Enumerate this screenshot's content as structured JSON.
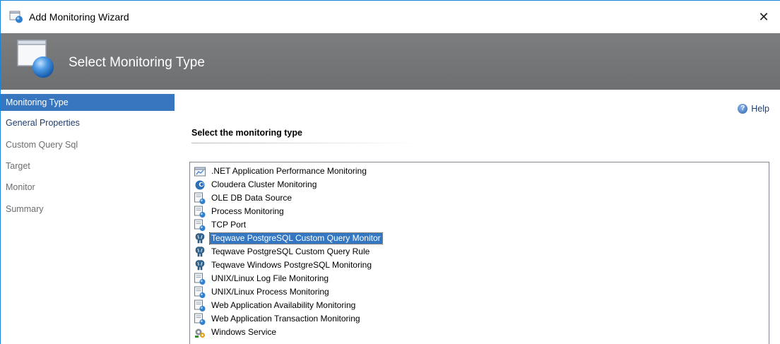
{
  "window": {
    "title": "Add Monitoring Wizard",
    "close_glyph": "✕"
  },
  "banner": {
    "title": "Select Monitoring Type"
  },
  "nav": {
    "items": [
      {
        "label": "Monitoring Type",
        "state": "active"
      },
      {
        "label": "General Properties",
        "state": "done"
      },
      {
        "label": "Custom Query Sql",
        "state": "pending"
      },
      {
        "label": "Target",
        "state": "pending"
      },
      {
        "label": "Monitor",
        "state": "pending"
      },
      {
        "label": "Summary",
        "state": "pending"
      }
    ]
  },
  "content": {
    "help_label": "Help",
    "help_icon": "help-icon",
    "section_title": "Select the monitoring type",
    "monitoring_types": [
      {
        "label": ".NET Application Performance Monitoring",
        "icon": "dotnet-app-icon",
        "selected": false
      },
      {
        "label": "Cloudera Cluster Monitoring",
        "icon": "cloudera-icon",
        "selected": false
      },
      {
        "label": "OLE DB Data Source",
        "icon": "monitor-page-icon",
        "selected": false
      },
      {
        "label": "Process Monitoring",
        "icon": "monitor-page-icon",
        "selected": false
      },
      {
        "label": "TCP Port",
        "icon": "monitor-page-icon",
        "selected": false
      },
      {
        "label": "Teqwave PostgreSQL Custom Query Monitor",
        "icon": "postgresql-elephant-icon",
        "selected": true
      },
      {
        "label": "Teqwave PostgreSQL Custom Query Rule",
        "icon": "postgresql-elephant-icon",
        "selected": false
      },
      {
        "label": "Teqwave Windows PostgreSQL Monitoring",
        "icon": "postgresql-elephant-icon",
        "selected": false
      },
      {
        "label": "UNIX/Linux Log File Monitoring",
        "icon": "monitor-page-icon",
        "selected": false
      },
      {
        "label": "UNIX/Linux Process Monitoring",
        "icon": "monitor-page-icon",
        "selected": false
      },
      {
        "label": "Web Application Availability Monitoring",
        "icon": "monitor-page-icon",
        "selected": false
      },
      {
        "label": "Web Application Transaction Monitoring",
        "icon": "monitor-page-icon",
        "selected": false
      },
      {
        "label": "Windows Service",
        "icon": "windows-service-icon",
        "selected": false
      }
    ]
  },
  "colors": {
    "banner_bg": "#767779",
    "selection_bg": "#3377c2",
    "nav_active_bg": "#3877c0",
    "window_border": "#1883d7"
  }
}
